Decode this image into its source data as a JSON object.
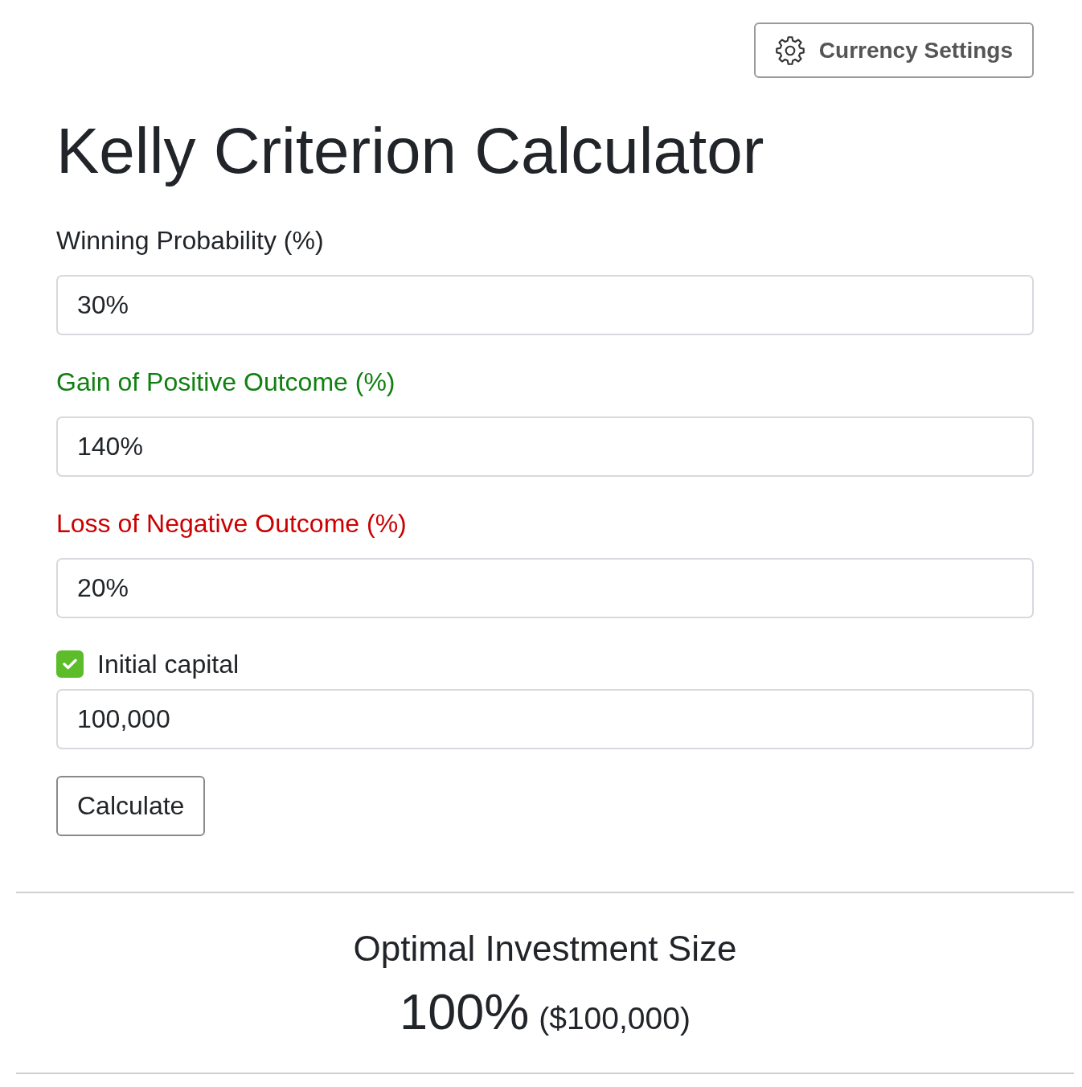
{
  "header": {
    "settings_button": "Currency Settings"
  },
  "title": "Kelly Criterion Calculator",
  "fields": [
    {
      "kind": "text",
      "label": "Winning Probability (%)",
      "color": "#212529",
      "value": "30%"
    },
    {
      "kind": "text",
      "label": "Gain of Positive Outcome (%)",
      "color": "#118011",
      "value": "140%"
    },
    {
      "kind": "text",
      "label": "Loss of Negative Outcome (%)",
      "color": "#cc0000",
      "value": "20%"
    },
    {
      "kind": "checkbox",
      "label": "Initial capital",
      "color": "#212529",
      "checked": true,
      "value": "100,000"
    }
  ],
  "calculate_button": "Calculate",
  "result": {
    "heading": "Optimal Investment Size",
    "percent": "100%",
    "amount": "($100,000)"
  }
}
